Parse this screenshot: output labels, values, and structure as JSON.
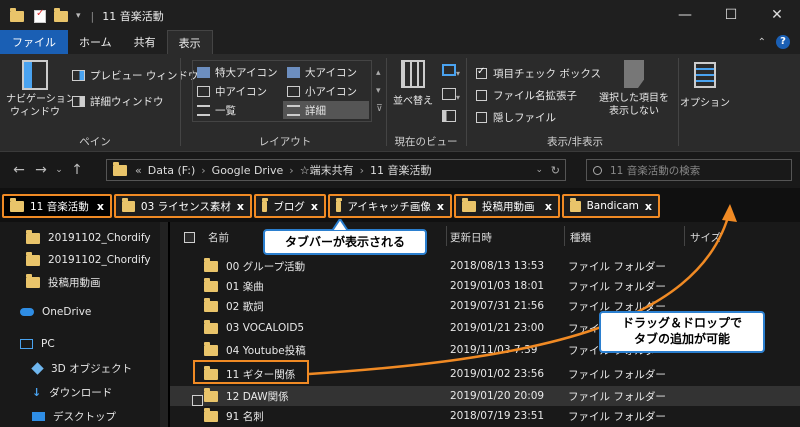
{
  "window": {
    "title": "11 音楽活動",
    "minimize": "—",
    "maximize": "☐",
    "close": "✕"
  },
  "ribbon_tabs": [
    "ファイル",
    "ホーム",
    "共有",
    "表示"
  ],
  "ribbon": {
    "pane_group": {
      "nav_pane": "ナビゲーション\nウィンドウ",
      "preview": "プレビュー ウィンドウ",
      "details": "詳細ウィンドウ",
      "label": "ペイン"
    },
    "layout_group": {
      "xl_icons": "特大アイコン",
      "l_icons": "大アイコン",
      "m_icons": "中アイコン",
      "s_icons": "小アイコン",
      "list": "一覧",
      "details": "詳細",
      "label": "レイアウト"
    },
    "view_group": {
      "sort": "並べ替え",
      "label": "現在のビュー"
    },
    "show_group": {
      "checkboxes": "項目チェック ボックス",
      "extensions": "ファイル名拡張子",
      "hidden": "隠しファイル",
      "hide_selected": "選択した項目を\n表示しない",
      "label": "表示/非表示"
    },
    "options": "オプション"
  },
  "address": {
    "crumbs": [
      "«",
      "Data (F:)",
      "Google Drive",
      "☆端末共有",
      "11 音楽活動"
    ],
    "search_placeholder": "11 音楽活動の検索"
  },
  "tabs": [
    {
      "label": "11 音楽活動",
      "close": "x"
    },
    {
      "label": "03 ライセンス素材",
      "close": "x"
    },
    {
      "label": "ブログ",
      "close": "x"
    },
    {
      "label": "アイキャッチ画像",
      "close": "x"
    },
    {
      "label": "投稿用動画",
      "close": "x"
    },
    {
      "label": "Bandicam",
      "close": "x"
    }
  ],
  "navpane": [
    "20191102_Chordify",
    "20191102_Chordify",
    "投稿用動画",
    "OneDrive",
    "PC",
    "3D オブジェクト",
    "ダウンロード",
    "デスクトップ"
  ],
  "columns": {
    "name": "名前",
    "date": "更新日時",
    "type": "種類",
    "size": "サイズ"
  },
  "files": [
    {
      "name": "00 グループ活動",
      "date": "2018/08/13 13:53",
      "type": "ファイル フォルダー"
    },
    {
      "name": "01 楽曲",
      "date": "2019/01/03 18:01",
      "type": "ファイル フォルダー"
    },
    {
      "name": "02 歌詞",
      "date": "2019/07/31 21:56",
      "type": "ファイル フォルダー"
    },
    {
      "name": "03 VOCALOID5",
      "date": "2019/01/21 23:00",
      "type": "ファイル フォルダー"
    },
    {
      "name": "04 Youtube投稿",
      "date": "2019/11/03 7:39",
      "type": "ファイル フォルダー"
    },
    {
      "name": "11 ギター関係",
      "date": "2019/01/02 23:56",
      "type": "ファイル フォルダー"
    },
    {
      "name": "12 DAW関係",
      "date": "2019/01/20 20:09",
      "type": "ファイル フォルダー"
    },
    {
      "name": "91 名刺",
      "date": "2018/07/19 23:51",
      "type": "ファイル フォルダー"
    }
  ],
  "annotations": {
    "tabbar_note": "タブバーが表示される",
    "dragdrop_note": "ドラッグ＆ドロップで\nタブの追加が可能"
  },
  "colors": {
    "accent_orange": "#f08a24",
    "file_tab_blue": "#1a5fb4",
    "callout_border": "#2b7fcf"
  }
}
